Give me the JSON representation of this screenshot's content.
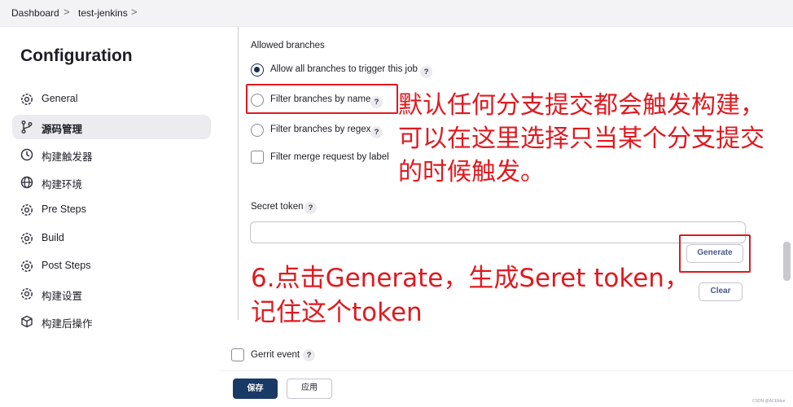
{
  "breadcrumb": {
    "items": [
      "Dashboard",
      "test-jenkins"
    ],
    "separator": ">"
  },
  "sidebar": {
    "title": "Configuration",
    "items": [
      {
        "label": "General",
        "icon": "gear-icon",
        "active": false
      },
      {
        "label": "源码管理",
        "icon": "branch-icon",
        "active": true
      },
      {
        "label": "构建触发器",
        "icon": "clock-icon",
        "active": false
      },
      {
        "label": "构建环境",
        "icon": "globe-icon",
        "active": false
      },
      {
        "label": "Pre Steps",
        "icon": "gear-icon",
        "active": false
      },
      {
        "label": "Build",
        "icon": "gear-icon",
        "active": false
      },
      {
        "label": "Post Steps",
        "icon": "gear-icon",
        "active": false
      },
      {
        "label": "构建设置",
        "icon": "gear-icon",
        "active": false
      },
      {
        "label": "构建后操作",
        "icon": "cube-icon",
        "active": false
      }
    ]
  },
  "branches": {
    "section_label": "Allowed branches",
    "options": [
      {
        "label": "Allow all branches to trigger this job",
        "type": "radio",
        "checked": true
      },
      {
        "label": "Filter branches by name",
        "type": "radio",
        "checked": false
      },
      {
        "label": "Filter branches by regex",
        "type": "radio",
        "checked": false
      },
      {
        "label": "Filter merge request by label",
        "type": "checkbox",
        "checked": false
      }
    ],
    "help_glyph": "?"
  },
  "secret_token": {
    "label": "Secret token",
    "value": "",
    "generate_label": "Generate",
    "clear_label": "Clear"
  },
  "gerrit": {
    "label": "Gerrit event",
    "checked": false
  },
  "footer": {
    "save_label": "保存",
    "apply_label": "应用"
  },
  "annotations": {
    "branch_note_line1": "默认任何分支提交都会触发构建，",
    "branch_note_line2": "可以在这里选择只当某个分支提交",
    "branch_note_line3": "的时候触发。",
    "generate_note_line1": "6.点击Generate，生成Seret token，",
    "generate_note_line2": "记住这个token",
    "color": "#e1191f"
  },
  "watermark": "CSDN @ACEblue"
}
